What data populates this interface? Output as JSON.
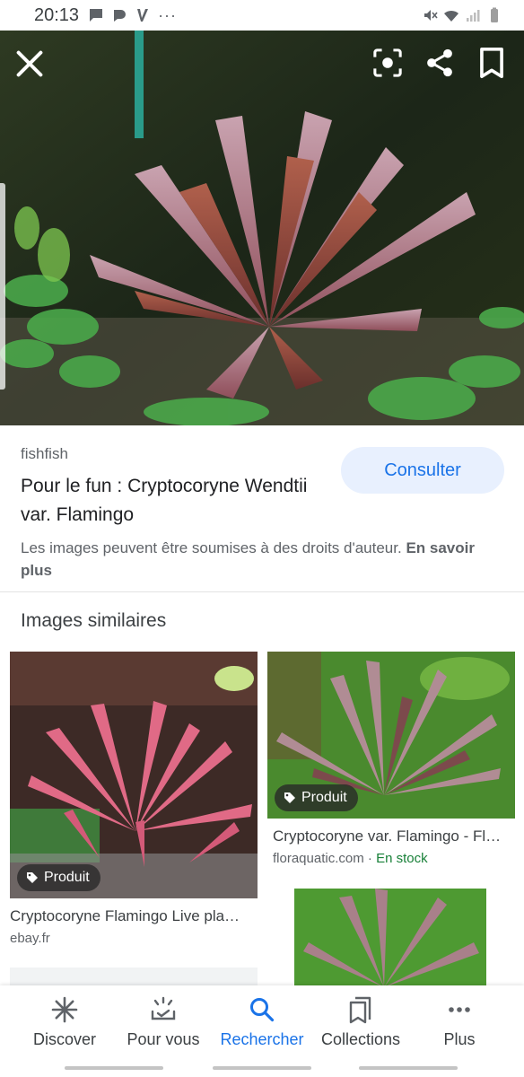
{
  "status_bar": {
    "time": "20:13",
    "more": "···"
  },
  "hero": {
    "close_icon": "close-icon",
    "actions": [
      "lens-icon",
      "share-icon",
      "bookmark-icon"
    ]
  },
  "result": {
    "source": "fishfish",
    "title": "Pour le fun : Cryptocoryne Wendtii var. Flamingo",
    "visit_label": "Consulter",
    "copyright_text": "Les images peuvent être soumises à des droits d'auteur.",
    "copyright_link": "En savoir plus"
  },
  "similar": {
    "heading": "Images similaires",
    "cards": [
      {
        "badge": "Produit",
        "title": "Cryptocoryne Flamingo Live pla…",
        "site": "ebay.fr",
        "stock": ""
      },
      {
        "badge": "Produit",
        "title": "Cryptocoryne var. Flamingo - Fl…",
        "site": "floraquatic.com",
        "separator": " · ",
        "stock": "En stock"
      }
    ]
  },
  "bottom_nav": {
    "items": [
      {
        "label": "Discover",
        "icon": "asterisk-icon"
      },
      {
        "label": "Pour vous",
        "icon": "updates-icon"
      },
      {
        "label": "Rechercher",
        "icon": "search-icon",
        "active": true
      },
      {
        "label": "Collections",
        "icon": "collections-icon"
      },
      {
        "label": "Plus",
        "icon": "more-icon"
      }
    ]
  },
  "colors": {
    "accent": "#1a73e8",
    "stock_green": "#188038",
    "button_bg": "#e8f0fe"
  }
}
